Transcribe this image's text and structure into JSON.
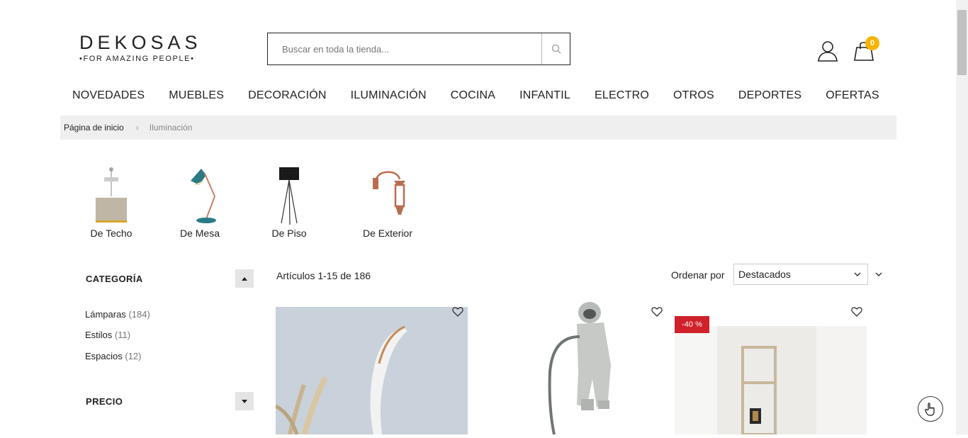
{
  "header": {
    "logo_word": "DEKOSAS",
    "logo_tagline": "•FOR AMAZING PEOPLE•",
    "search_placeholder": "Buscar en toda la tienda...",
    "cart_count": "0"
  },
  "nav": {
    "items": [
      "NOVEDADES",
      "MUEBLES",
      "DECORACIÓN",
      "ILUMINACIÓN",
      "COCINA",
      "INFANTIL",
      "ELECTRO",
      "OTROS",
      "DEPORTES",
      "OFERTAS"
    ]
  },
  "breadcrumb": {
    "home": "Página de inicio",
    "separator": "›",
    "current": "Iluminación"
  },
  "subcategories": [
    "De Techo",
    "De Mesa",
    "De Piso",
    "De Exterior"
  ],
  "sidebar": {
    "category_title": "CATEGORÍA",
    "categories": [
      {
        "label": "Lámparas",
        "count": "(184)"
      },
      {
        "label": "Estilos",
        "count": "(11)"
      },
      {
        "label": "Espacios",
        "count": "(12)"
      }
    ],
    "price_title": "PRECIO"
  },
  "toolbar": {
    "count_text": "Artículos 1-15 de 186",
    "sort_label": "Ordenar por",
    "sort_selected": "Destacados"
  },
  "products": {
    "discount_badge": "-40 %"
  },
  "colors": {
    "badge": "#d0202a",
    "cart_badge": "#f5b400",
    "breadcrumb_bg": "#efefef"
  }
}
